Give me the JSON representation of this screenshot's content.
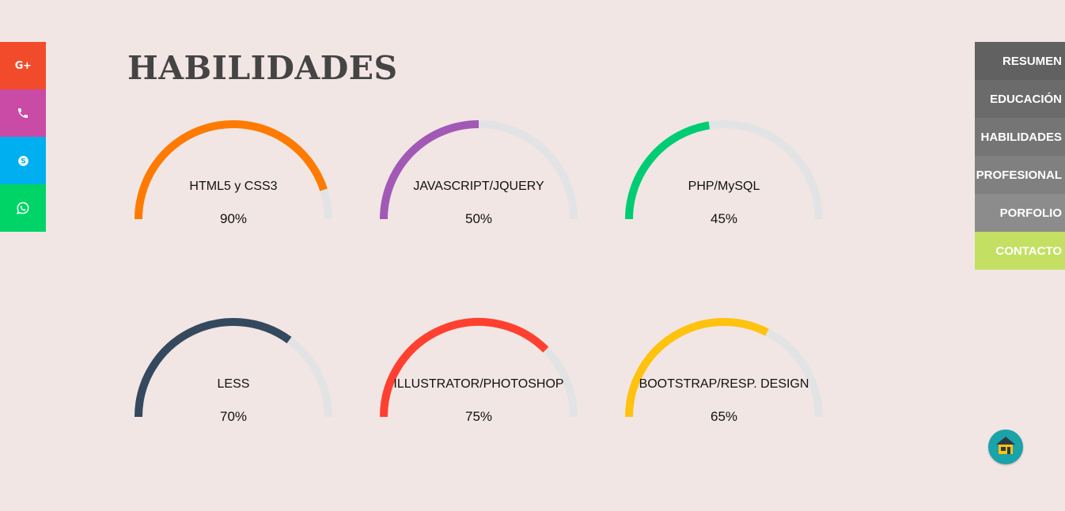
{
  "page": {
    "title": "HABILIDADES",
    "background": "#f1e6e4"
  },
  "social": [
    {
      "name": "google-plus",
      "icon": "google-plus-icon",
      "label": "G+",
      "color": "#f24b2b"
    },
    {
      "name": "phone",
      "icon": "phone-icon",
      "color": "#c94ba6"
    },
    {
      "name": "skype",
      "icon": "skype-icon",
      "color": "#00aff0"
    },
    {
      "name": "whatsapp",
      "icon": "whatsapp-icon",
      "color": "#00d466"
    }
  ],
  "skills": [
    {
      "label": "HTML5 y CSS3",
      "percent_text": "90%",
      "value": 90,
      "color": "#ff7a00"
    },
    {
      "label": "JAVASCRIPT/JQUERY",
      "percent_text": "50%",
      "value": 50,
      "color": "#a259b5"
    },
    {
      "label": "PHP/MySQL",
      "percent_text": "45%",
      "value": 45,
      "color": "#00cc74"
    },
    {
      "label": "LESS",
      "percent_text": "70%",
      "value": 70,
      "color": "#34495e"
    },
    {
      "label": "ILLUSTRATOR/PHOTOSHOP",
      "percent_text": "75%",
      "value": 75,
      "color": "#ff4030"
    },
    {
      "label": "BOOTSTRAP/RESP. DESIGN",
      "percent_text": "65%",
      "value": 65,
      "color": "#ffc20e"
    }
  ],
  "gauge_track_color": "#e2e3e5",
  "nav": [
    {
      "label": "RESUMEN",
      "color": "#616161"
    },
    {
      "label": "EDUCACIÓN",
      "color": "#6b6b6b"
    },
    {
      "label": "HABILIDADES",
      "color": "#757575"
    },
    {
      "label": "PROFESIONAL",
      "color": "#808080"
    },
    {
      "label": "PORFOLIO",
      "color": "#8c8c8c"
    },
    {
      "label": "CONTACTO",
      "color": "#c3e063"
    }
  ],
  "home_button": {
    "icon": "home-icon",
    "color": "#1aa3a8"
  }
}
